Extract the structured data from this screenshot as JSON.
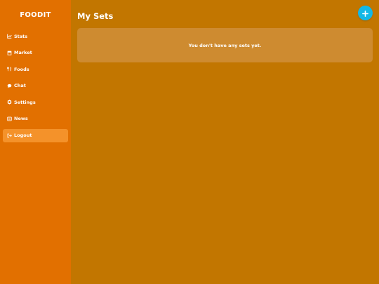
{
  "app": {
    "brand": "FOODIT",
    "colors": {
      "sidebar": "#e27000",
      "main_background": "#c27600",
      "active_item": "#f4922a",
      "accent": "#13b8e6",
      "card": "#ce8b30"
    }
  },
  "sidebar": {
    "items": [
      {
        "label": "Stats",
        "icon": "chart-line-icon"
      },
      {
        "label": "Market",
        "icon": "store-icon"
      },
      {
        "label": "Foods",
        "icon": "utensils-icon"
      },
      {
        "label": "Chat",
        "icon": "chat-bubble-icon"
      },
      {
        "label": "Settings",
        "icon": "gear-icon"
      },
      {
        "label": "News",
        "icon": "newspaper-icon"
      },
      {
        "label": "Logout",
        "icon": "logout-icon",
        "active": true
      }
    ]
  },
  "main": {
    "title": "My Sets",
    "add_button_icon": "plus-icon",
    "empty_message": "You don't have any sets yet."
  }
}
